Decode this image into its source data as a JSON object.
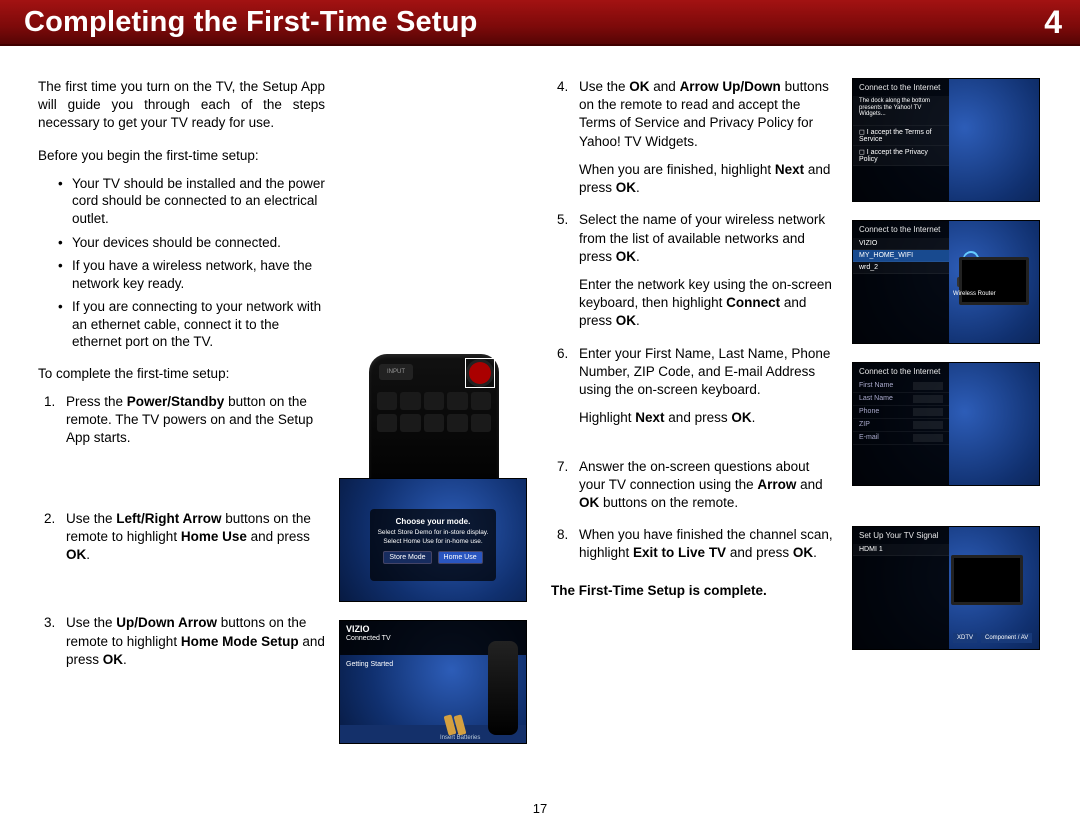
{
  "header": {
    "title": "Completing the First-Time Setup",
    "chapter": "4"
  },
  "intro": "The first time you turn on the TV, the Setup App will guide you through each of the steps necessary to get your TV ready for use.",
  "before_lead": "Before you begin the first-time setup:",
  "before_items": [
    "Your TV should be installed and the power cord should be connected to an electrical outlet.",
    "Your devices should be connected.",
    "If you have a wireless network, have the network key ready.",
    "If you are connecting to your network with an ethernet cable, connect it to the ethernet port on the TV."
  ],
  "complete_lead": "To complete the first-time setup:",
  "steps_left": [
    {
      "pre": "Press the ",
      "bold": "Power/Standby",
      "post": " button on the remote. The TV powers on and the Setup App starts."
    },
    {
      "pre": "Use the ",
      "bold": "Left/Right Arrow",
      "post": " buttons on the remote to highlight ",
      "bold2": "Home Use",
      "post2": " and press ",
      "bold3": "OK",
      "post3": "."
    },
    {
      "pre": "Use the ",
      "bold": "Up/Down Arrow",
      "post": " buttons on the remote to highlight ",
      "bold2": "Home Mode Setup",
      "post2": " and press ",
      "bold3": "OK",
      "post3": "."
    }
  ],
  "steps_right": [
    {
      "pre": "Use the ",
      "bold": "OK",
      "mid": " and ",
      "bold2": "Arrow Up/Down",
      "post": " buttons on the remote to read and accept the Terms of Service and Privacy Policy for Yahoo! TV Widgets.",
      "sub_pre": "When you are finished, highlight ",
      "sub_bold": "Next",
      "sub_mid": " and press ",
      "sub_bold2": "OK",
      "sub_post": "."
    },
    {
      "pre": "Select the name of your wireless network from the list of available networks and press ",
      "bold": "OK",
      "post": ".",
      "sub_pre": "Enter the network key using the on-screen keyboard, then highlight ",
      "sub_bold": "Connect",
      "sub_mid": " and press ",
      "sub_bold2": "OK",
      "sub_post": "."
    },
    {
      "pre": "Enter your First Name, Last Name, Phone Number, ZIP Code, and E-mail Address using the on-screen keyboard.",
      "sub_pre": "Highlight ",
      "sub_bold": "Next",
      "sub_mid": " and press ",
      "sub_bold2": "OK",
      "sub_post": "."
    },
    {
      "pre": "Answer the on-screen questions about your TV connection using the ",
      "bold": "Arrow",
      "mid": " and ",
      "bold2": "OK",
      "post": " buttons on the remote."
    },
    {
      "pre": "When you have finished the channel scan, highlight ",
      "bold": "Exit to Live TV",
      "mid": " and press ",
      "bold2": "OK",
      "post": "."
    }
  ],
  "complete_msg": "The First-Time Setup is complete.",
  "page_number": "17",
  "shots": {
    "remote_input": "INPUT",
    "mode_title": "Choose your mode.",
    "mode_l1": "Select Store Demo for in-store display.",
    "mode_l2": "Select Home Use for in-home use.",
    "mode_store": "Store Mode",
    "mode_home": "Home Use",
    "connected_brand": "VIZIO",
    "connected_sub": "Connected TV",
    "connected_getting": "Getting Started",
    "connected_ib": "Insert Batteries",
    "net_title": "Connect to the Internet",
    "net_vizio": "VIZIO",
    "net_myhome": "MY_HOME_WIFI",
    "net_wrd2": "wrd_2",
    "net_router": "Wireless Router",
    "sig_title": "Set Up Your TV Signal",
    "sig_hdtv": "XDTV",
    "sig_comp": "Component / AV",
    "sig_hdmi": "HDMI 1"
  }
}
